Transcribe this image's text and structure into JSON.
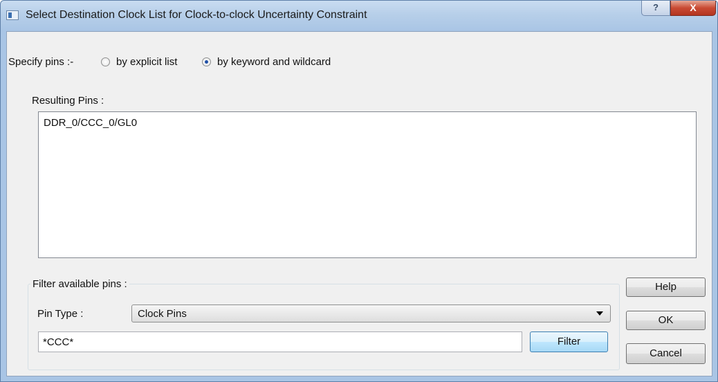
{
  "window": {
    "title": "Select Destination Clock List for Clock-to-clock Uncertainty Constraint",
    "help_glyph": "?",
    "close_glyph": "X"
  },
  "specify": {
    "label": "Specify pins :-",
    "options": [
      {
        "label": "by explicit list",
        "selected": false
      },
      {
        "label": "by keyword and wildcard",
        "selected": true
      }
    ]
  },
  "results": {
    "label": "Resulting Pins :",
    "items": [
      "DDR_0/CCC_0/GL0"
    ]
  },
  "filter": {
    "group_label": "Filter available pins :",
    "pin_type_label": "Pin Type :",
    "pin_type_value": "Clock Pins",
    "pattern_value": "*CCC*",
    "filter_button": "Filter"
  },
  "buttons": {
    "help": "Help",
    "ok": "OK",
    "cancel": "Cancel"
  },
  "icons": {
    "app": "dialog-app-icon",
    "dropdown": "chevron-down-icon"
  }
}
